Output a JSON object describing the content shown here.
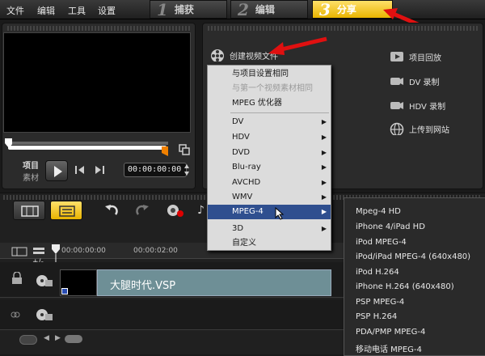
{
  "menu": [
    "文件",
    "编辑",
    "工具",
    "设置"
  ],
  "steps": [
    {
      "num": "1",
      "label": "捕获"
    },
    {
      "num": "2",
      "label": "编辑"
    },
    {
      "num": "3",
      "label": "分享"
    }
  ],
  "player": {
    "project_label": "项目",
    "clip_label": "素材",
    "timecode": "00:00:00:00"
  },
  "share": {
    "create_video": "创建视频文件",
    "project_playback": "项目回放",
    "dv_record": "DV 录制",
    "hdv_record": "HDV 录制",
    "upload_web": "上传到网站"
  },
  "create_menu": [
    {
      "label": "与项目设置相同",
      "disabled": false,
      "arrow": false
    },
    {
      "label": "与第一个视频素材相同",
      "disabled": true,
      "arrow": false
    },
    {
      "label": "MPEG 优化器",
      "disabled": false,
      "arrow": false
    },
    {
      "label": "DV",
      "disabled": false,
      "arrow": true
    },
    {
      "label": "HDV",
      "disabled": false,
      "arrow": true
    },
    {
      "label": "DVD",
      "disabled": false,
      "arrow": true
    },
    {
      "label": "Blu-ray",
      "disabled": false,
      "arrow": true
    },
    {
      "label": "AVCHD",
      "disabled": false,
      "arrow": true
    },
    {
      "label": "WMV",
      "disabled": false,
      "arrow": true
    },
    {
      "label": "MPEG-4",
      "disabled": false,
      "arrow": true,
      "selected": true
    },
    {
      "label": "3D",
      "disabled": false,
      "arrow": true
    },
    {
      "label": "自定义",
      "disabled": false,
      "arrow": false
    }
  ],
  "mpeg4_menu": [
    "Mpeg-4 HD",
    "iPhone 4/iPad HD",
    "iPod MPEG-4",
    "iPod/iPad MPEG-4 (640x480)",
    "iPod H.264",
    "iPhone H.264 (640x480)",
    "PSP MPEG-4",
    "PSP H.264",
    "PDA/PMP MPEG-4",
    "移动电话 MPEG-4"
  ],
  "timeline": {
    "ruler_start": "00:00:00:00",
    "ruler_mark": "00:00:02:00",
    "zoom": "+/-",
    "clip_name": "大腿时代.VSP"
  },
  "colors": {
    "accent": "#f5c518",
    "highlight": "#2f4f8f",
    "arrow": "#e01010"
  }
}
